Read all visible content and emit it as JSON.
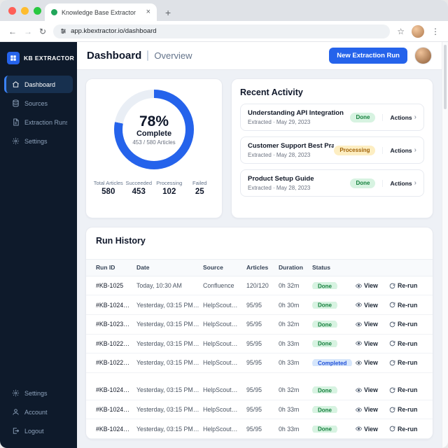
{
  "browser": {
    "tab_title": "Knowledge Base Extractor",
    "url": "app.kbextractor.io/dashboard"
  },
  "sidebar": {
    "logo_text": "KB EXTRACTOR",
    "items": [
      {
        "label": "Dashboard"
      },
      {
        "label": "Sources"
      },
      {
        "label": "Extraction Runs"
      },
      {
        "label": "Settings"
      }
    ],
    "footer_items": [
      {
        "label": "Settings"
      },
      {
        "label": "Account"
      },
      {
        "label": "Logout"
      }
    ]
  },
  "header": {
    "title": "Dashboard",
    "subtitle": "Overview",
    "cta_label": "New Extraction Run"
  },
  "progress": {
    "percent_label": "78%",
    "percent_value": 78,
    "label": "Complete",
    "detail": "453 / 580 Articles",
    "stats": [
      {
        "label": "Total Articles",
        "value": "580"
      },
      {
        "label": "Succeeded",
        "value": "453"
      },
      {
        "label": "Processing",
        "value": "102"
      },
      {
        "label": "Failed",
        "value": "25"
      }
    ]
  },
  "recent_activity": {
    "title": "Recent Activity",
    "action_label": "Actions",
    "items": [
      {
        "title": "Understanding API Integration",
        "subtitle": "Extracted · May 29, 2023",
        "badge": "Done",
        "badge_type": "done"
      },
      {
        "title": "Customer Support Best Practices",
        "subtitle": "Extracted · May 28, 2023",
        "badge": "Processing",
        "badge_type": "processing"
      },
      {
        "title": "Product Setup Guide",
        "subtitle": "Extracted · May 28, 2023",
        "badge": "Done",
        "badge_type": "done"
      }
    ]
  },
  "run_history": {
    "title": "Run History",
    "columns": [
      "Run ID",
      "Date",
      "Source",
      "Articles",
      "Duration",
      "Status"
    ],
    "labels": {
      "view": "View",
      "rerun": "Re-run"
    },
    "rows": [
      {
        "id": "#KB-1025",
        "date": "Today, 10:30 AM",
        "source": "Confluence",
        "articles": "120/120",
        "duration": "0h 32m",
        "status": "Done",
        "status_type": "done"
      },
      {
        "id": "#KB-1024…",
        "date": "Yesterday, 03:15 PM…",
        "source": "HelpScout…",
        "articles": "95/95",
        "duration": "0h 30m",
        "status": "Done",
        "status_type": "done"
      },
      {
        "id": "#KB-1023…",
        "date": "Yesterday, 03:15 PM…",
        "source": "HelpScout…",
        "articles": "95/95",
        "duration": "0h 32m",
        "status": "Done",
        "status_type": "done"
      },
      {
        "id": "#KB-1022…",
        "date": "Yesterday, 03:15 PM…",
        "source": "HelpScout…",
        "articles": "95/95",
        "duration": "0h 33m",
        "status": "Done",
        "status_type": "done"
      },
      {
        "id": "#KB-1022…",
        "date": "Yesterday, 03:15 PM…",
        "source": "HelpScout…",
        "articles": "95/95",
        "duration": "0h 33m",
        "status": "Completed",
        "status_type": "completed"
      },
      {
        "id": "#KB-1024…",
        "date": "Yesterday, 03:15 PM…",
        "source": "HelpScout…",
        "articles": "95/95",
        "duration": "0h 32m",
        "status": "Done",
        "status_type": "done"
      },
      {
        "id": "#KB-1024…",
        "date": "Yesterday, 03:15 PM…",
        "source": "HelpScout…",
        "articles": "95/95",
        "duration": "0h 33m",
        "status": "Done",
        "status_type": "done"
      },
      {
        "id": "#KB-1024…",
        "date": "Yesterday, 03:15 PM…",
        "source": "HelpScout…",
        "articles": "95/95",
        "duration": "0h 33m",
        "status": "Done",
        "status_type": "done"
      }
    ]
  },
  "colors": {
    "accent": "#2563eb",
    "donut_track": "#e9eef5",
    "done_bg": "#d7f3e1",
    "done_text": "#15803d",
    "processing_bg": "#fdeec2",
    "processing_text": "#a16207",
    "completed_bg": "#d6e6fb",
    "completed_text": "#1d4ed8"
  }
}
